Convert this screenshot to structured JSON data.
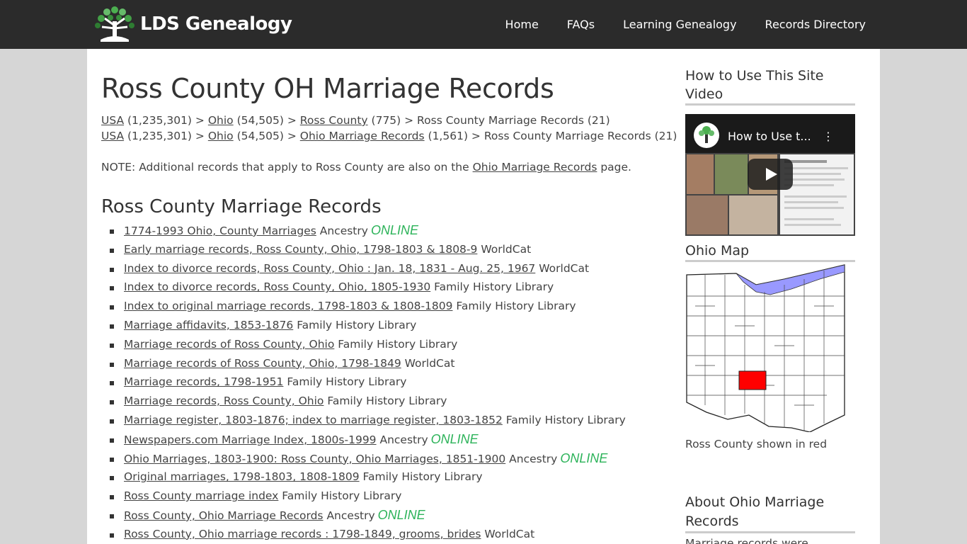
{
  "header": {
    "logo_text": "LDS Genealogy",
    "nav": [
      "Home",
      "FAQs",
      "Learning Genealogy",
      "Records Directory"
    ]
  },
  "main": {
    "title": "Ross County OH Marriage Records",
    "breadcrumbs": [
      [
        {
          "text": "USA",
          "link": true
        },
        {
          "text": " (1,235,301) > ",
          "link": false
        },
        {
          "text": "Ohio",
          "link": true
        },
        {
          "text": " (54,505) > ",
          "link": false
        },
        {
          "text": "Ross County",
          "link": true
        },
        {
          "text": " (775) > Ross County Marriage Records (21)",
          "link": false
        }
      ],
      [
        {
          "text": "USA",
          "link": true
        },
        {
          "text": " (1,235,301) > ",
          "link": false
        },
        {
          "text": "Ohio",
          "link": true
        },
        {
          "text": " (54,505) > ",
          "link": false
        },
        {
          "text": "Ohio Marriage Records",
          "link": true
        },
        {
          "text": " (1,561) > Ross County Marriage Records (21)",
          "link": false
        }
      ]
    ],
    "note_prefix": "NOTE: Additional records that apply to Ross County are also on the ",
    "note_link": "Ohio Marriage Records",
    "note_suffix": " page.",
    "section_title": "Ross County Marriage Records",
    "online_label": "ONLINE",
    "records": [
      {
        "title": "1774-1993 Ohio, County Marriages",
        "source": "Ancestry",
        "online": true
      },
      {
        "title": "Early marriage records, Ross County, Ohio, 1798-1803 & 1808-9",
        "source": "WorldCat",
        "online": false
      },
      {
        "title": "Index to divorce records, Ross County, Ohio : Jan. 18, 1831 - Aug. 25, 1967",
        "source": "WorldCat",
        "online": false
      },
      {
        "title": "Index to divorce records, Ross County, Ohio, 1805-1930",
        "source": "Family History Library",
        "online": false
      },
      {
        "title": "Index to original marriage records, 1798-1803 & 1808-1809",
        "source": "Family History Library",
        "online": false
      },
      {
        "title": "Marriage affidavits, 1853-1876",
        "source": "Family History Library",
        "online": false
      },
      {
        "title": "Marriage records of Ross County, Ohio",
        "source": "Family History Library",
        "online": false
      },
      {
        "title": "Marriage records of Ross County, Ohio, 1798-1849",
        "source": "WorldCat",
        "online": false
      },
      {
        "title": "Marriage records, 1798-1951",
        "source": "Family History Library",
        "online": false
      },
      {
        "title": "Marriage records, Ross County, Ohio",
        "source": "Family History Library",
        "online": false
      },
      {
        "title": "Marriage register, 1803-1876; index to marriage register, 1803-1852",
        "source": "Family History Library",
        "online": false
      },
      {
        "title": "Newspapers.com Marriage Index, 1800s-1999",
        "source": "Ancestry",
        "online": true
      },
      {
        "title": "Ohio Marriages, 1803-1900: Ross County, Ohio Marriages, 1851-1900",
        "source": "Ancestry",
        "online": true
      },
      {
        "title": "Original marriages, 1798-1803, 1808-1809",
        "source": "Family History Library",
        "online": false
      },
      {
        "title": "Ross County marriage index",
        "source": "Family History Library",
        "online": false
      },
      {
        "title": "Ross County, Ohio Marriage Records",
        "source": "Ancestry",
        "online": true
      },
      {
        "title": "Ross County, Ohio marriage records : 1798-1849, grooms, brides",
        "source": "WorldCat",
        "online": false
      }
    ]
  },
  "sidebar": {
    "video_heading": "How to Use This Site Video",
    "video_title": "How to Use t...",
    "map_heading": "Ohio Map",
    "map_caption": "Ross County shown in red",
    "about_heading": "About Ohio Marriage Records",
    "about_text": "Marriage records were generally kept from the date"
  },
  "colors": {
    "topbar": "#2b2b2b",
    "background": "#d6d6d6",
    "online": "#2db35a",
    "highlight_county": "#ff0000",
    "lake": "#9999ff"
  }
}
